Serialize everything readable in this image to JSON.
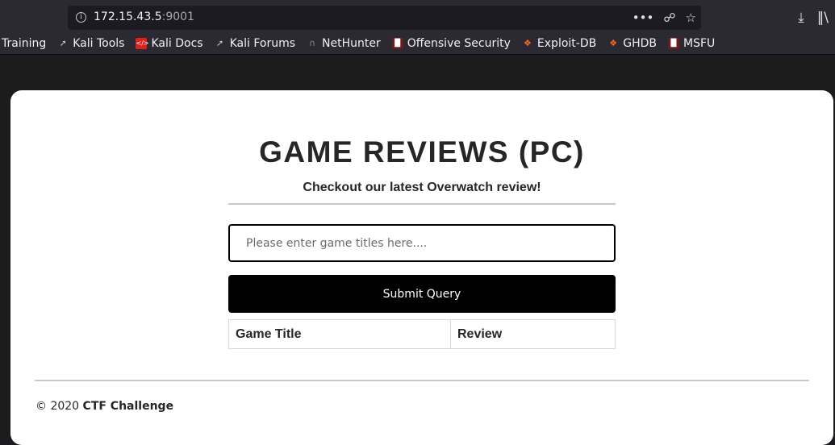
{
  "browser": {
    "url_host": "172.15.43.5",
    "url_port": ":9001",
    "bookmarks": [
      {
        "label": "Training",
        "icon": "none"
      },
      {
        "label": "Kali Tools",
        "icon": "kali-dragon-icon"
      },
      {
        "label": "Kali Docs",
        "icon": "kali-docs-icon"
      },
      {
        "label": "Kali Forums",
        "icon": "kali-dragon-icon"
      },
      {
        "label": "NetHunter",
        "icon": "nethunter-icon"
      },
      {
        "label": "Offensive Security",
        "icon": "offsec-icon"
      },
      {
        "label": "Exploit-DB",
        "icon": "exploit-db-icon"
      },
      {
        "label": "GHDB",
        "icon": "exploit-db-icon"
      },
      {
        "label": "MSFU",
        "icon": "offsec-icon"
      }
    ]
  },
  "page": {
    "title": "GAME REVIEWS (PC)",
    "subtitle": "Checkout our latest Overwatch review!",
    "search_placeholder": "Please enter game titles here....",
    "submit_label": "Submit Query",
    "table_headers": [
      "Game Title",
      "Review"
    ],
    "footer_prefix": "© 2020",
    "footer_brand": "CTF Challenge"
  }
}
